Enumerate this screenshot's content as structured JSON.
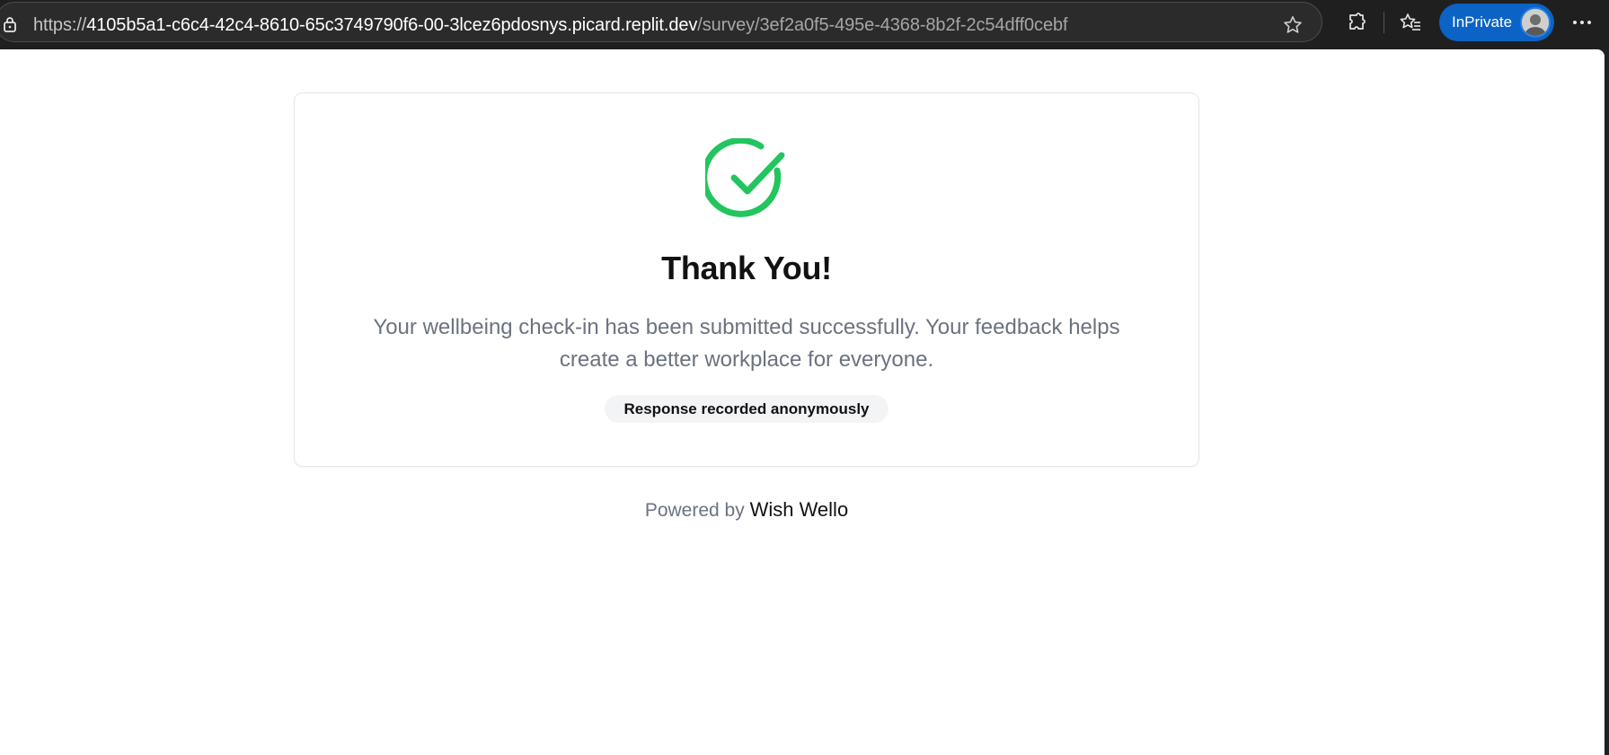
{
  "browser": {
    "url": {
      "scheme": "https://",
      "host": "4105b5a1-c6c4-42c4-8610-65c3749790f6-00-3lcez6pdosnys.picard.replit.dev",
      "path": "/survey/3ef2a0f5-495e-4368-8b2f-2c54dff0cebf"
    },
    "inprivate_label": "InPrivate",
    "icons": [
      "lock-icon",
      "star-icon",
      "extensions-icon",
      "favorites-icon",
      "more-icon"
    ]
  },
  "confirmation": {
    "title": "Thank You!",
    "message": "Your wellbeing check-in has been submitted successfully. Your feedback helps create a better workplace for everyone.",
    "badge": "Response recorded anonymously"
  },
  "footer": {
    "prefix": "Powered by",
    "brand": "Wish Wello"
  },
  "colors": {
    "success": "#22c55e",
    "inprivate": "#0b63c5",
    "muted_text": "#6b7280"
  }
}
